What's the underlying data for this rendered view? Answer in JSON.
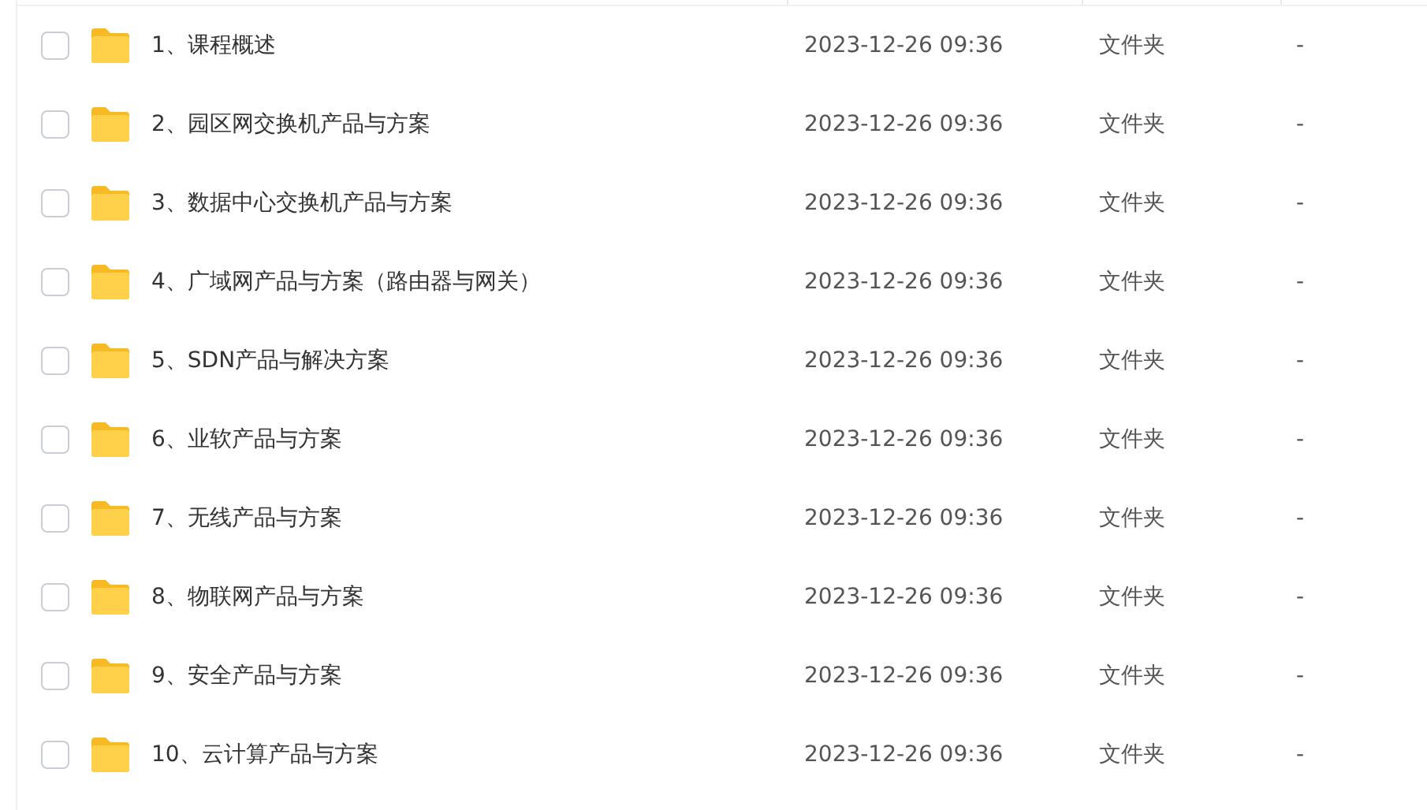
{
  "files": [
    {
      "name": "1、课程概述",
      "modified": "2023-12-26 09:36",
      "type": "文件夹",
      "size": "-",
      "checked": false
    },
    {
      "name": "2、园区网交换机产品与方案",
      "modified": "2023-12-26 09:36",
      "type": "文件夹",
      "size": "-",
      "checked": false
    },
    {
      "name": "3、数据中心交换机产品与方案",
      "modified": "2023-12-26 09:36",
      "type": "文件夹",
      "size": "-",
      "checked": false
    },
    {
      "name": "4、广域网产品与方案（路由器与网关）",
      "modified": "2023-12-26 09:36",
      "type": "文件夹",
      "size": "-",
      "checked": false
    },
    {
      "name": "5、SDN产品与解决方案",
      "modified": "2023-12-26 09:36",
      "type": "文件夹",
      "size": "-",
      "checked": false
    },
    {
      "name": "6、业软产品与方案",
      "modified": "2023-12-26 09:36",
      "type": "文件夹",
      "size": "-",
      "checked": false
    },
    {
      "name": "7、无线产品与方案",
      "modified": "2023-12-26 09:36",
      "type": "文件夹",
      "size": "-",
      "checked": false
    },
    {
      "name": "8、物联网产品与方案",
      "modified": "2023-12-26 09:36",
      "type": "文件夹",
      "size": "-",
      "checked": false
    },
    {
      "name": "9、安全产品与方案",
      "modified": "2023-12-26 09:36",
      "type": "文件夹",
      "size": "-",
      "checked": false
    },
    {
      "name": "10、云计算产品与方案",
      "modified": "2023-12-26 09:36",
      "type": "文件夹",
      "size": "-",
      "checked": false
    }
  ]
}
